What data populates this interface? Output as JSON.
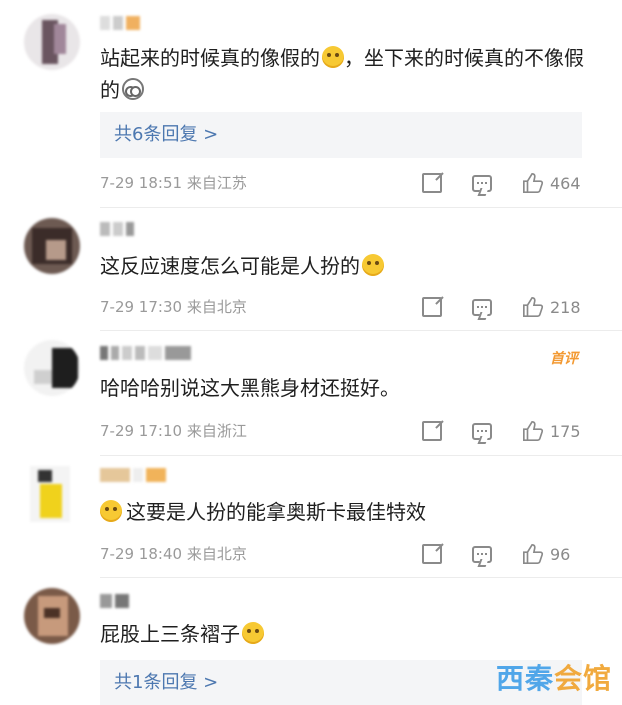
{
  "comments": [
    {
      "text_before": "站起来的时候真的像假的",
      "text_mid": "，坐下来的时候真的不像假的",
      "replies": "共6条回复 >",
      "time": "7-29 18:51",
      "location": "来自江苏",
      "likes": "464"
    },
    {
      "text_before": "这反应速度怎么可能是人扮的",
      "time": "7-29 17:30",
      "location": "来自北京",
      "likes": "218"
    },
    {
      "text_before": "哈哈哈别说这大黑熊身材还挺好。",
      "badge": "首评",
      "time": "7-29 17:10",
      "location": "来自浙江",
      "likes": "175"
    },
    {
      "text_after": "这要是人扮的能拿奥斯卡最佳特效",
      "time": "7-29 18:40",
      "location": "来自北京",
      "likes": "96"
    },
    {
      "text_before": "屁股上三条褶子",
      "replies": "共1条回复 >"
    }
  ],
  "watermark": {
    "part1": "西秦",
    "part2": "会馆"
  },
  "icons": [
    "share-icon",
    "comment-icon",
    "like-icon",
    "emoji-icon"
  ],
  "colors": {
    "link": "#4d78b0",
    "meta": "#9a9a9a",
    "badge": "#f39a33"
  }
}
